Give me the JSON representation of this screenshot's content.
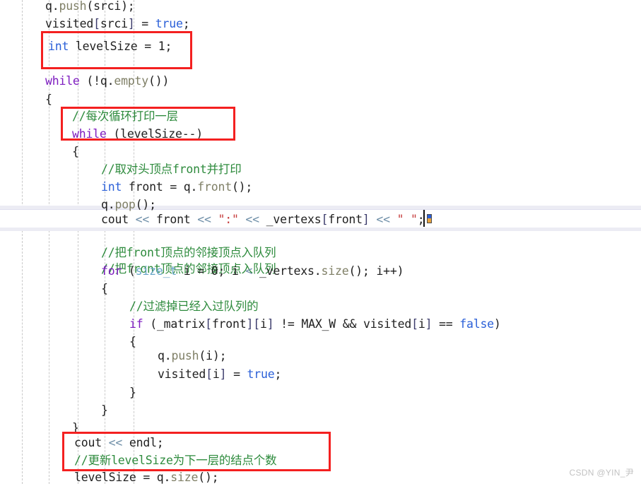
{
  "editor": {
    "background_color": "#ffffff",
    "current_line_highlight_color": "#ececf4",
    "indent_guide_color": "#c9c9c9",
    "annotation_color": "#f42020",
    "caret_color": "#111111"
  },
  "code_lines": [
    {
      "indent": 3,
      "text": "q.push(srci);"
    },
    {
      "indent": 3,
      "text": "visited[srci] = true;"
    },
    {
      "indent": 3,
      "text": "int levelSize = 1;"
    },
    {
      "indent": 3,
      "text": ""
    },
    {
      "indent": 3,
      "text": "while (!q.empty())"
    },
    {
      "indent": 3,
      "text": "{"
    },
    {
      "indent": 4,
      "text": "//每次循环打印一层"
    },
    {
      "indent": 4,
      "text": "while (levelSize--)"
    },
    {
      "indent": 4,
      "text": "{"
    },
    {
      "indent": 5,
      "text": "//取对头顶点front并打印"
    },
    {
      "indent": 5,
      "text": "int front = q.front();"
    },
    {
      "indent": 5,
      "text": "q.pop();"
    },
    {
      "indent": 5,
      "text": "cout << front << \":\" << _vertexs[front] << \" \";"
    },
    {
      "indent": 5,
      "text": ""
    },
    {
      "indent": 5,
      "text": "//把front顶点的邻接顶点入队列"
    },
    {
      "indent": 5,
      "text": "for (size_t i = 0; i < _vertexs.size(); i++)"
    },
    {
      "indent": 5,
      "text": "{"
    },
    {
      "indent": 6,
      "text": "//过滤掉已经入过队列的"
    },
    {
      "indent": 6,
      "text": "if (_matrix[front][i] != MAX_W && visited[i] == false)"
    },
    {
      "indent": 6,
      "text": "{"
    },
    {
      "indent": 7,
      "text": "q.push(i);"
    },
    {
      "indent": 7,
      "text": "visited[i] = true;"
    },
    {
      "indent": 6,
      "text": "}"
    },
    {
      "indent": 5,
      "text": "}"
    },
    {
      "indent": 4,
      "text": "}"
    },
    {
      "indent": 4,
      "text": "cout << endl;"
    },
    {
      "indent": 4,
      "text": "//更新levelSize为下一层的结点个数"
    },
    {
      "indent": 4,
      "text": "levelSize = q.size();"
    }
  ],
  "annotations": [
    {
      "name": "level-size-init-box",
      "label": "int levelSize = 1;"
    },
    {
      "name": "level-loop-box",
      "label": "//每次循环打印一层 / while (levelSize--)"
    },
    {
      "name": "level-update-box",
      "label": "cout << endl; / //更新levelSize为下一层的结点个数"
    }
  ],
  "current_line": {
    "text": "cout << front << \":\" << _vertexs[front] << \" \";",
    "caret_after": "\" \""
  },
  "watermark": {
    "text": "CSDN @YIN_尹"
  }
}
